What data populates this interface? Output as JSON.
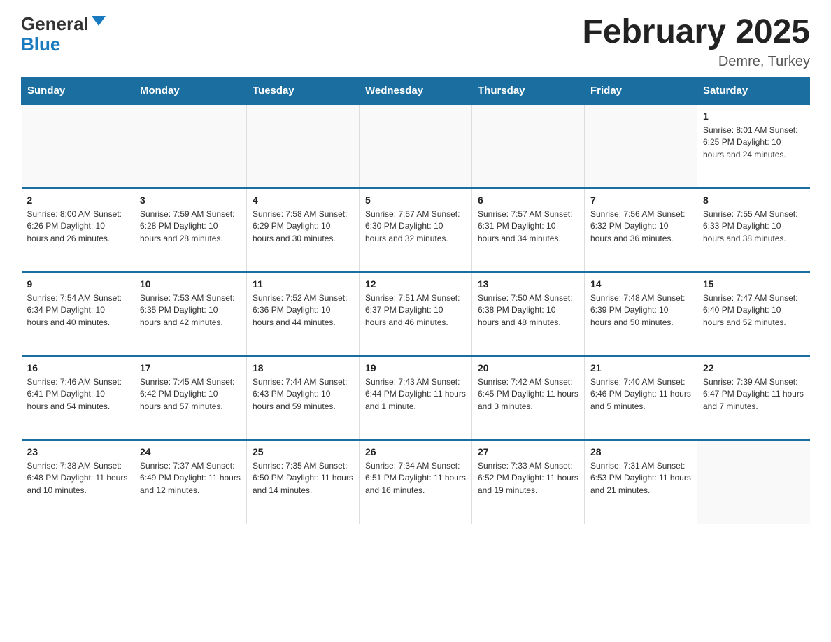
{
  "header": {
    "logo_general": "General",
    "logo_blue": "Blue",
    "month_title": "February 2025",
    "location": "Demre, Turkey"
  },
  "days_of_week": [
    "Sunday",
    "Monday",
    "Tuesday",
    "Wednesday",
    "Thursday",
    "Friday",
    "Saturday"
  ],
  "weeks": [
    [
      {
        "day": "",
        "info": ""
      },
      {
        "day": "",
        "info": ""
      },
      {
        "day": "",
        "info": ""
      },
      {
        "day": "",
        "info": ""
      },
      {
        "day": "",
        "info": ""
      },
      {
        "day": "",
        "info": ""
      },
      {
        "day": "1",
        "info": "Sunrise: 8:01 AM\nSunset: 6:25 PM\nDaylight: 10 hours and 24 minutes."
      }
    ],
    [
      {
        "day": "2",
        "info": "Sunrise: 8:00 AM\nSunset: 6:26 PM\nDaylight: 10 hours and 26 minutes."
      },
      {
        "day": "3",
        "info": "Sunrise: 7:59 AM\nSunset: 6:28 PM\nDaylight: 10 hours and 28 minutes."
      },
      {
        "day": "4",
        "info": "Sunrise: 7:58 AM\nSunset: 6:29 PM\nDaylight: 10 hours and 30 minutes."
      },
      {
        "day": "5",
        "info": "Sunrise: 7:57 AM\nSunset: 6:30 PM\nDaylight: 10 hours and 32 minutes."
      },
      {
        "day": "6",
        "info": "Sunrise: 7:57 AM\nSunset: 6:31 PM\nDaylight: 10 hours and 34 minutes."
      },
      {
        "day": "7",
        "info": "Sunrise: 7:56 AM\nSunset: 6:32 PM\nDaylight: 10 hours and 36 minutes."
      },
      {
        "day": "8",
        "info": "Sunrise: 7:55 AM\nSunset: 6:33 PM\nDaylight: 10 hours and 38 minutes."
      }
    ],
    [
      {
        "day": "9",
        "info": "Sunrise: 7:54 AM\nSunset: 6:34 PM\nDaylight: 10 hours and 40 minutes."
      },
      {
        "day": "10",
        "info": "Sunrise: 7:53 AM\nSunset: 6:35 PM\nDaylight: 10 hours and 42 minutes."
      },
      {
        "day": "11",
        "info": "Sunrise: 7:52 AM\nSunset: 6:36 PM\nDaylight: 10 hours and 44 minutes."
      },
      {
        "day": "12",
        "info": "Sunrise: 7:51 AM\nSunset: 6:37 PM\nDaylight: 10 hours and 46 minutes."
      },
      {
        "day": "13",
        "info": "Sunrise: 7:50 AM\nSunset: 6:38 PM\nDaylight: 10 hours and 48 minutes."
      },
      {
        "day": "14",
        "info": "Sunrise: 7:48 AM\nSunset: 6:39 PM\nDaylight: 10 hours and 50 minutes."
      },
      {
        "day": "15",
        "info": "Sunrise: 7:47 AM\nSunset: 6:40 PM\nDaylight: 10 hours and 52 minutes."
      }
    ],
    [
      {
        "day": "16",
        "info": "Sunrise: 7:46 AM\nSunset: 6:41 PM\nDaylight: 10 hours and 54 minutes."
      },
      {
        "day": "17",
        "info": "Sunrise: 7:45 AM\nSunset: 6:42 PM\nDaylight: 10 hours and 57 minutes."
      },
      {
        "day": "18",
        "info": "Sunrise: 7:44 AM\nSunset: 6:43 PM\nDaylight: 10 hours and 59 minutes."
      },
      {
        "day": "19",
        "info": "Sunrise: 7:43 AM\nSunset: 6:44 PM\nDaylight: 11 hours and 1 minute."
      },
      {
        "day": "20",
        "info": "Sunrise: 7:42 AM\nSunset: 6:45 PM\nDaylight: 11 hours and 3 minutes."
      },
      {
        "day": "21",
        "info": "Sunrise: 7:40 AM\nSunset: 6:46 PM\nDaylight: 11 hours and 5 minutes."
      },
      {
        "day": "22",
        "info": "Sunrise: 7:39 AM\nSunset: 6:47 PM\nDaylight: 11 hours and 7 minutes."
      }
    ],
    [
      {
        "day": "23",
        "info": "Sunrise: 7:38 AM\nSunset: 6:48 PM\nDaylight: 11 hours and 10 minutes."
      },
      {
        "day": "24",
        "info": "Sunrise: 7:37 AM\nSunset: 6:49 PM\nDaylight: 11 hours and 12 minutes."
      },
      {
        "day": "25",
        "info": "Sunrise: 7:35 AM\nSunset: 6:50 PM\nDaylight: 11 hours and 14 minutes."
      },
      {
        "day": "26",
        "info": "Sunrise: 7:34 AM\nSunset: 6:51 PM\nDaylight: 11 hours and 16 minutes."
      },
      {
        "day": "27",
        "info": "Sunrise: 7:33 AM\nSunset: 6:52 PM\nDaylight: 11 hours and 19 minutes."
      },
      {
        "day": "28",
        "info": "Sunrise: 7:31 AM\nSunset: 6:53 PM\nDaylight: 11 hours and 21 minutes."
      },
      {
        "day": "",
        "info": ""
      }
    ]
  ]
}
